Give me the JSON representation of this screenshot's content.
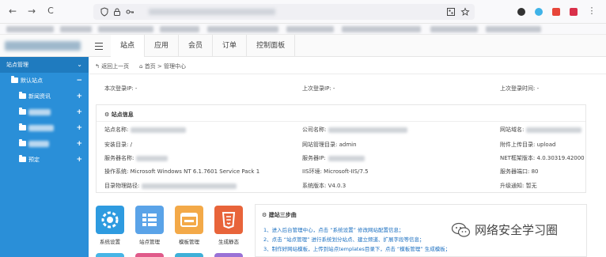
{
  "browser": {
    "back_glyph": "←",
    "forward_glyph": "→",
    "reload_glyph": "C",
    "icons": [
      "shield-icon",
      "lock-icon",
      "key-icon",
      "qr-icon",
      "star-icon"
    ]
  },
  "header": {
    "tabs": [
      "站点",
      "应用",
      "会员",
      "订单",
      "控制面板"
    ]
  },
  "sidebar": {
    "head": "站点管理",
    "head_chevron": "⌄",
    "items": [
      {
        "label": "默认站点",
        "toggle": "−"
      },
      {
        "label": "新闻资讯",
        "toggle": "+"
      },
      {
        "label": "",
        "toggle": "+"
      },
      {
        "label": "",
        "toggle": "+"
      },
      {
        "label": "",
        "toggle": "+"
      },
      {
        "label": "预定",
        "toggle": "+"
      }
    ]
  },
  "breadcrumb": {
    "back": "返回上一页",
    "home": "首页",
    "sep": ">",
    "current": "管理中心"
  },
  "login": {
    "ip": "本次登录IP:  -",
    "last_ip": "上次登录IP:  -",
    "last_time": "上次登录时间:  -"
  },
  "site_info": {
    "title": "站点信息",
    "rows": {
      "site_name": "站点名称:",
      "company": "公司名称:",
      "domain": "网站域名:",
      "install_dir": "安装目录: /",
      "manage_dir": "网站管理目录: admin",
      "upload_dir": "附件上传目录: upload",
      "server_name": "服务器名称:",
      "server_ip": "服务器IP:",
      "net_version": "NET框架版本: 4.0.30319.42000",
      "os": "操作系统: Microsoft Windows NT 6.1.7601 Service Pack 1",
      "iis": "IIS环境: Microsoft-IIS/7.5",
      "port": "服务器端口: 80",
      "physical_path": "目录物理路径:",
      "sys_version": "系统版本: V4.0.3",
      "upgrade": "升级通知: 暂无"
    }
  },
  "apps": [
    {
      "label": "系统设置",
      "color": "#2e9be0"
    },
    {
      "label": "站点管理",
      "color": "#5aa3e8"
    },
    {
      "label": "模板管理",
      "color": "#f3a948"
    },
    {
      "label": "生成静态",
      "color": "#e8643a"
    }
  ],
  "steps": {
    "title": "建站三步曲",
    "items": [
      "1、进入后台管理中心，点击 “系统设置” 修改网站配置信息；",
      "2、点击 “站点管理” 进行系统划分站点、建立频道、扩展字段等信息；",
      "3、制作好网站模板，上传到站点templates目录下，点击 “模板管理” 生成模板；"
    ]
  },
  "watermark": {
    "text": "网络安全学习圈"
  },
  "colors": {
    "sidebar": "#2a8fd8",
    "sidebar_head": "#1f7bbf",
    "link": "#1a6fc0"
  }
}
